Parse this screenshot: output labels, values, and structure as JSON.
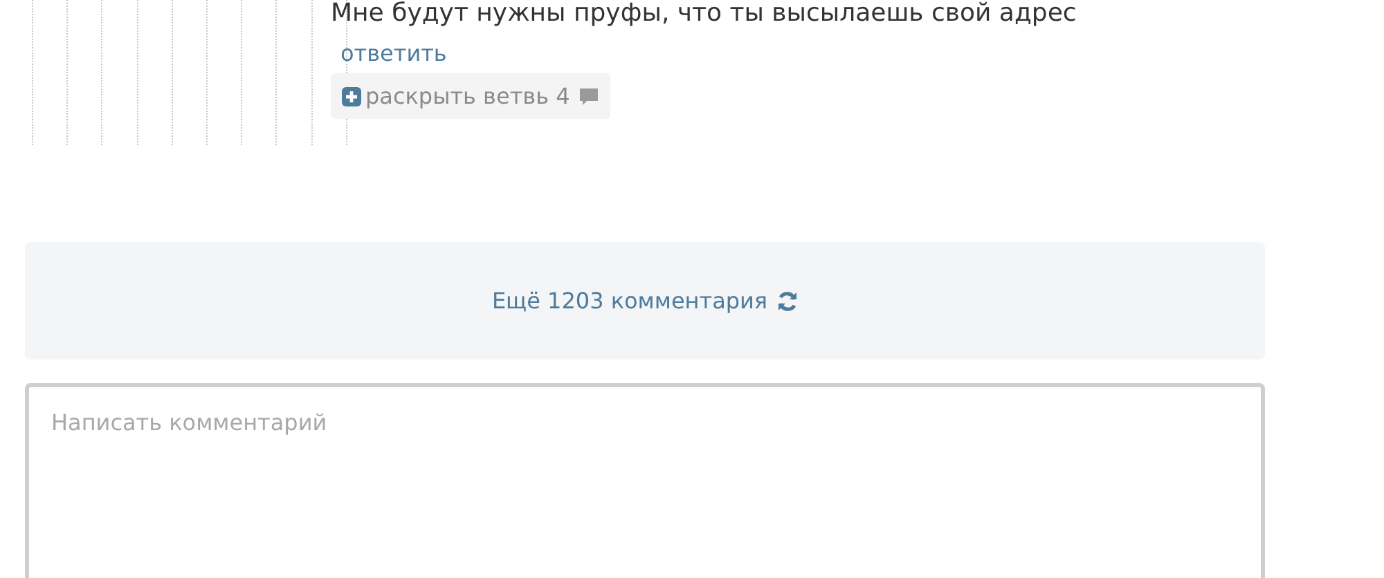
{
  "comment": {
    "text": "Мне будут нужны пруфы, что ты высылаешь свой адрес",
    "reply_link": "ответить",
    "expand_thread": {
      "label": "раскрыть ветвь 4"
    }
  },
  "load_more": {
    "label": "Ещё 1203 комментария"
  },
  "comment_form": {
    "placeholder": "Написать комментарий"
  }
}
